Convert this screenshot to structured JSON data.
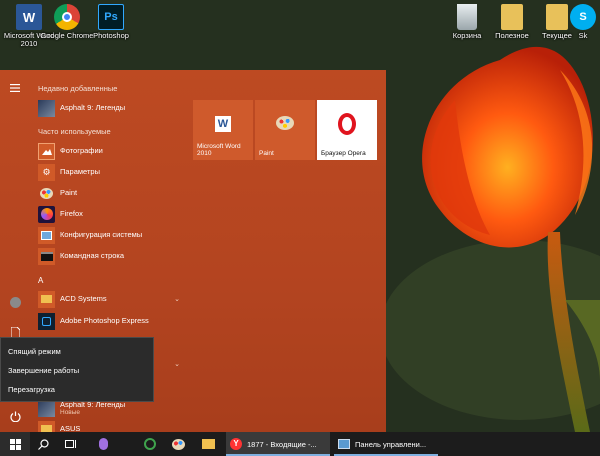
{
  "desktop": {
    "icons": [
      {
        "label": "Microsoft Word 2010",
        "icon": "word-icon",
        "color": "#2b5797"
      },
      {
        "label": "Google Chrome",
        "icon": "chrome-icon",
        "color": "#4285f4"
      },
      {
        "label": "Photoshop",
        "icon": "photoshop-icon",
        "color": "#001d26"
      },
      {
        "label": "Корзина",
        "icon": "recycle-bin-icon",
        "color": "#cfd8dc"
      },
      {
        "label": "Полезное",
        "icon": "folder-icon",
        "color": "#e8c15a"
      },
      {
        "label": "Текущее",
        "icon": "folder-icon",
        "color": "#e8c15a"
      },
      {
        "label": "Sk",
        "icon": "skype-icon",
        "color": "#00aff0"
      }
    ]
  },
  "start_menu": {
    "accent": "#b8461f",
    "recent_header": "Недавно добавленные",
    "recent": [
      {
        "label": "Asphalt 9: Легенды",
        "icon": "asphalt-icon"
      }
    ],
    "frequent_header": "Часто используемые",
    "frequent": [
      {
        "label": "Фотографии",
        "icon": "photos-icon"
      },
      {
        "label": "Параметры",
        "icon": "gear-icon"
      },
      {
        "label": "Paint",
        "icon": "paint-icon"
      },
      {
        "label": "Firefox",
        "icon": "firefox-icon"
      },
      {
        "label": "Конфигурация системы",
        "icon": "msconfig-icon"
      },
      {
        "label": "Командная строка",
        "icon": "cmd-icon"
      }
    ],
    "letter_a": "A",
    "a_apps": [
      {
        "label": "ACD Systems",
        "icon": "folder-icon"
      },
      {
        "label": "Adobe Photoshop Express",
        "icon": "ps-express-icon"
      }
    ],
    "bottom_apps": [
      {
        "label": "Asphalt 9: Легенды",
        "sub": "Новые",
        "icon": "asphalt-icon"
      },
      {
        "label": "ASUS",
        "icon": "folder-icon"
      }
    ],
    "tiles": [
      {
        "label": "Microsoft Word 2010",
        "icon": "word-icon"
      },
      {
        "label": "Paint",
        "icon": "paint-icon"
      },
      {
        "label": "Браузер Opera",
        "icon": "opera-icon"
      }
    ],
    "power_menu": {
      "items": [
        "Спящий режим",
        "Завершение работы",
        "Перезагрузка"
      ]
    }
  },
  "taskbar": {
    "tasks": [
      {
        "label": "1877 - Входящие -...",
        "icon": "yandex-icon"
      },
      {
        "label": "Панель управлени...",
        "icon": "control-panel-icon"
      }
    ]
  }
}
